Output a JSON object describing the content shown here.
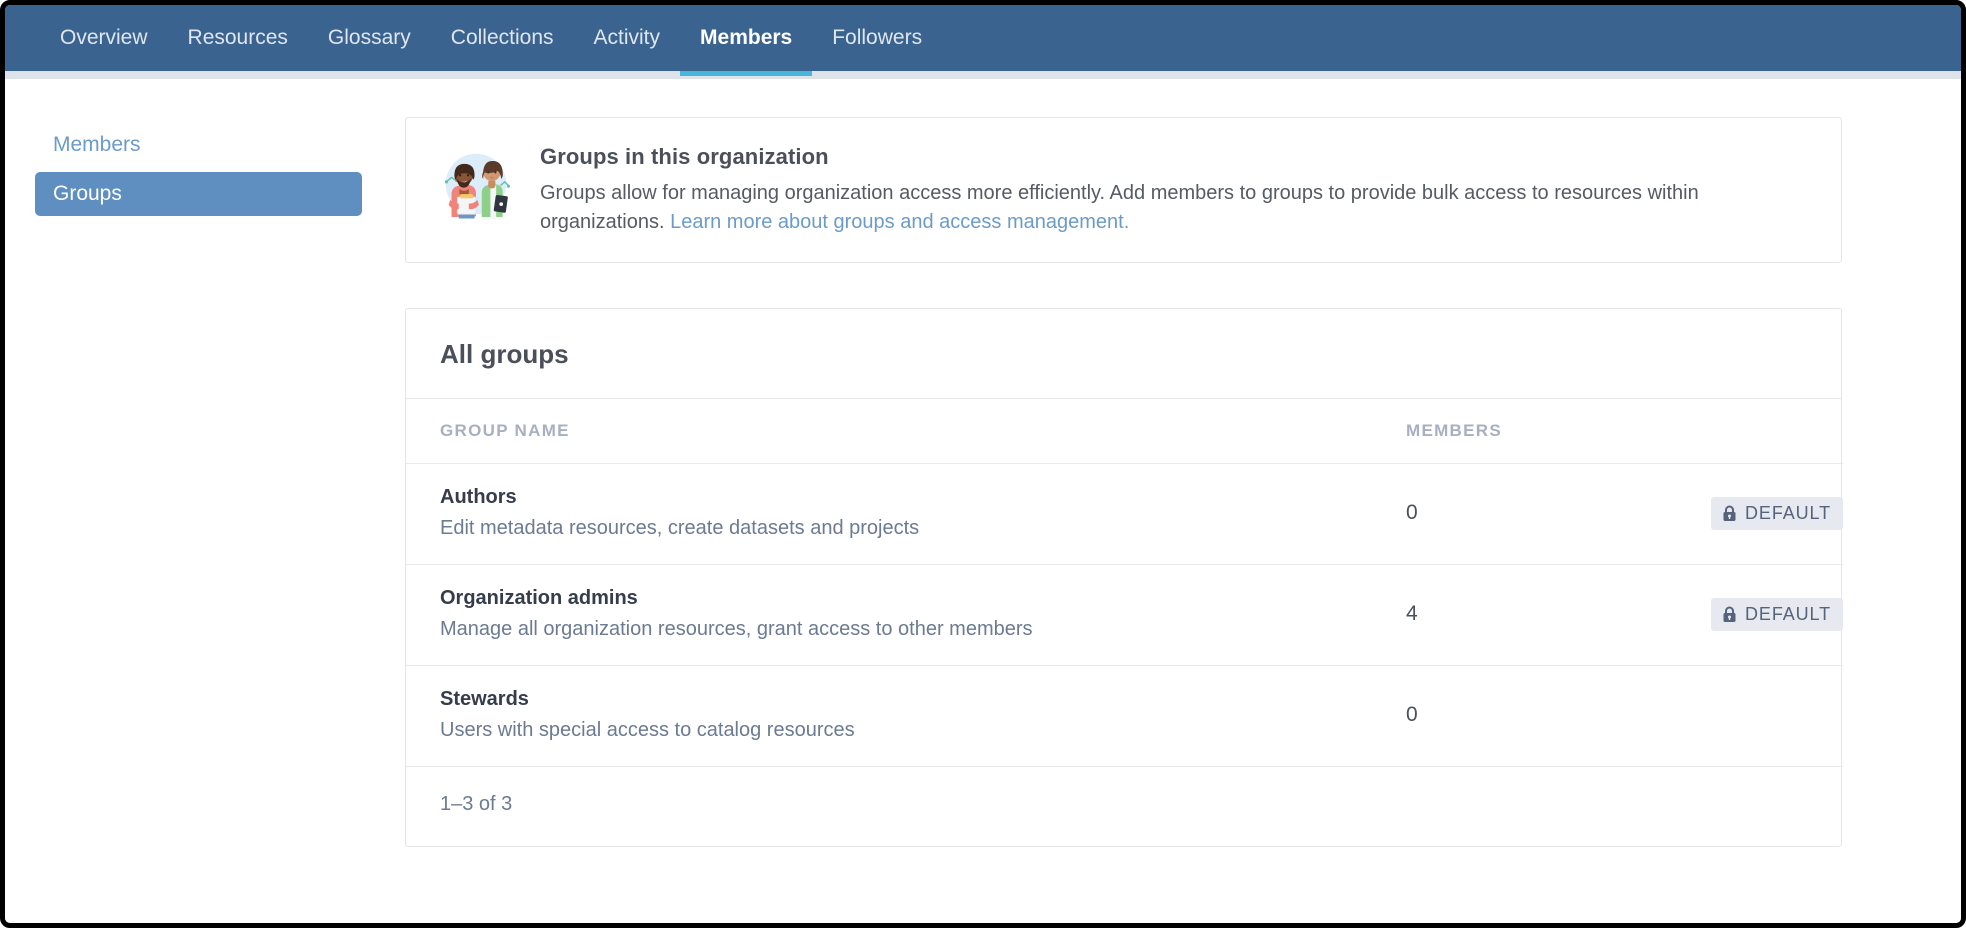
{
  "nav": {
    "items": [
      {
        "label": "Overview",
        "active": false
      },
      {
        "label": "Resources",
        "active": false
      },
      {
        "label": "Glossary",
        "active": false
      },
      {
        "label": "Collections",
        "active": false
      },
      {
        "label": "Activity",
        "active": false
      },
      {
        "label": "Members",
        "active": true
      },
      {
        "label": "Followers",
        "active": false
      }
    ],
    "active_label": "Members",
    "bar_color": "#3a6390",
    "active_underline_color": "#46b6d9"
  },
  "sidebar": {
    "items": [
      {
        "label": "Members",
        "selected": false
      },
      {
        "label": "Groups",
        "selected": true
      }
    ],
    "selected_color": "#5e8fc0",
    "link_color": "#6b9bc9"
  },
  "info_card": {
    "illustration_name": "two-people-illustration",
    "title": "Groups in this organization",
    "body_text": "Groups allow for managing organization access more efficiently. Add members to groups to provide bulk access to resources within organizations. ",
    "link_text": "Learn more about groups and access management.",
    "link_color": "#6b9bc9"
  },
  "groups_card": {
    "title": "All groups",
    "columns": [
      "GROUP NAME",
      "MEMBERS",
      ""
    ],
    "rows": [
      {
        "name": "Authors",
        "description": "Edit metadata resources, create datasets and projects",
        "members": "0",
        "badge": "DEFAULT",
        "badge_icon": "lock-icon"
      },
      {
        "name": "Organization admins",
        "description": "Manage all organization resources, grant access to other members",
        "members": "4",
        "badge": "DEFAULT",
        "badge_icon": "lock-icon"
      },
      {
        "name": "Stewards",
        "description": "Users with special access to catalog resources",
        "members": "0",
        "badge": "",
        "badge_icon": ""
      }
    ],
    "pagination_label": "1–3 of 3"
  }
}
